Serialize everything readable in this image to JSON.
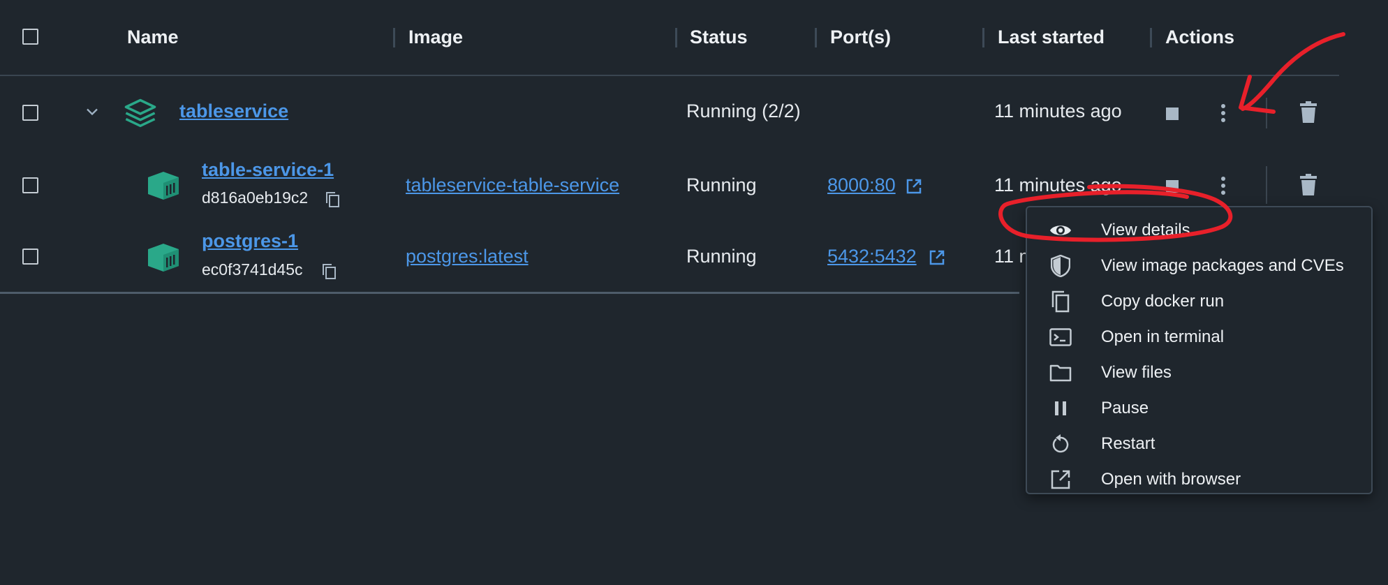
{
  "header": {
    "name": "Name",
    "image": "Image",
    "status": "Status",
    "ports": "Port(s)",
    "last_started": "Last started",
    "actions": "Actions"
  },
  "rows": [
    {
      "name": "tableservice",
      "image": "",
      "status": "Running (2/2)",
      "ports": "",
      "last_started": "11 minutes ago",
      "icon": "stack-icon"
    },
    {
      "name": "table-service-1",
      "id": "d816a0eb19c2",
      "image": "tableservice-table-service",
      "status": "Running",
      "ports": "8000:80",
      "last_started": "11 minutes ago",
      "icon": "container-icon"
    },
    {
      "name": "postgres-1",
      "id": "ec0f3741d45c",
      "image": "postgres:latest",
      "status": "Running",
      "ports": "5432:5432",
      "last_started": "11 m",
      "icon": "container-icon"
    }
  ],
  "menu": {
    "items": [
      {
        "label": "View details",
        "icon": "eye-icon"
      },
      {
        "label": "View image packages and CVEs",
        "icon": "shield-icon"
      },
      {
        "label": "Copy docker run",
        "icon": "copy-icon"
      },
      {
        "label": "Open in terminal",
        "icon": "terminal-icon"
      },
      {
        "label": "View files",
        "icon": "folder-icon"
      },
      {
        "label": "Pause",
        "icon": "pause-icon"
      },
      {
        "label": "Restart",
        "icon": "restart-icon"
      },
      {
        "label": "Open with browser",
        "icon": "open-external-icon"
      }
    ]
  },
  "colors": {
    "background": "#1f262d",
    "link": "#4c97e8",
    "accent_teal": "#2aa889",
    "annotation_red": "#e8202a"
  }
}
